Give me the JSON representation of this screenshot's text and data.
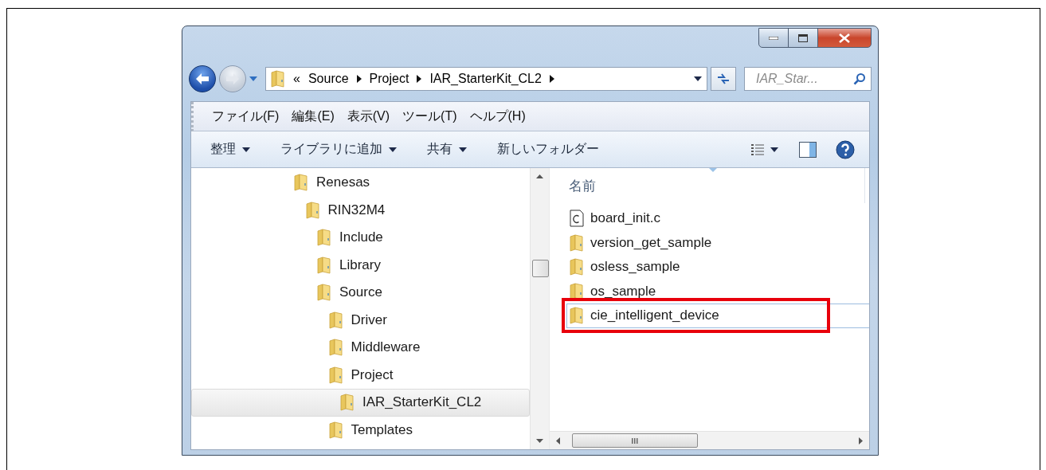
{
  "address_bar": {
    "overflow": "«",
    "crumbs": [
      "Source",
      "Project",
      "IAR_StarterKit_CL2"
    ]
  },
  "search": {
    "placeholder": "IAR_Star..."
  },
  "menu": [
    "ファイル(F)",
    "編集(E)",
    "表示(V)",
    "ツール(T)",
    "ヘルプ(H)"
  ],
  "toolbar": [
    {
      "label": "整理",
      "dropdown": true
    },
    {
      "label": "ライブラリに追加",
      "dropdown": true
    },
    {
      "label": "共有",
      "dropdown": true
    },
    {
      "label": "新しいフォルダー",
      "dropdown": false
    }
  ],
  "tree": [
    {
      "label": "Renesas",
      "selected": false,
      "children": [
        {
          "label": "RIN32M4",
          "selected": false,
          "children": [
            {
              "label": "Include",
              "selected": false
            },
            {
              "label": "Library",
              "selected": false
            },
            {
              "label": "Source",
              "selected": false,
              "children": [
                {
                  "label": "Driver",
                  "selected": false
                },
                {
                  "label": "Middleware",
                  "selected": false
                },
                {
                  "label": "Project",
                  "selected": false,
                  "children": [
                    {
                      "label": "IAR_StarterKit_CL2",
                      "selected": true
                    }
                  ]
                },
                {
                  "label": "Templates",
                  "selected": false
                }
              ]
            }
          ]
        }
      ]
    }
  ],
  "file_list": {
    "column": "名前",
    "items": [
      {
        "name": "board_init.c",
        "kind": "file",
        "selected": false,
        "highlighted": false
      },
      {
        "name": "version_get_sample",
        "kind": "folder",
        "selected": false,
        "highlighted": false
      },
      {
        "name": "osless_sample",
        "kind": "folder",
        "selected": false,
        "highlighted": false
      },
      {
        "name": "os_sample",
        "kind": "folder",
        "selected": false,
        "highlighted": false
      },
      {
        "name": "cie_intelligent_device",
        "kind": "folder",
        "selected": true,
        "highlighted": true
      }
    ]
  }
}
